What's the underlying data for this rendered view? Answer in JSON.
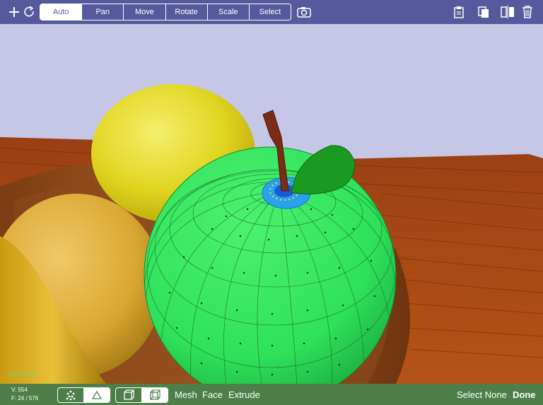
{
  "toolbar": {
    "add_icon": "plus-icon",
    "redo_icon": "redo-icon",
    "modes": [
      "Auto",
      "Pan",
      "Move",
      "Rotate",
      "Scale",
      "Select"
    ],
    "active_mode": "Auto",
    "camera_icon": "camera-icon",
    "right_icons": [
      "clipboard-icon",
      "duplicate-icon",
      "mirror-icon",
      "trash-icon"
    ],
    "bar_color": "#565a9c"
  },
  "status": {
    "mode_label": "Edit Mode",
    "vertices": "V: 554",
    "faces": "F: 24 / 576"
  },
  "bottom_bar": {
    "selection_modes": [
      "vertices-icon",
      "triangle-icon"
    ],
    "active_selection_mode": "vertices-icon",
    "view_modes": [
      "cube-icon",
      "cube-outline-icon"
    ],
    "active_view_mode": "cube-outline-icon",
    "mesh_label": "Mesh",
    "face_label": "Face",
    "extrude_label": "Extrude",
    "select_none_label": "Select None",
    "done_label": "Done",
    "bar_color": "#4e7f49"
  },
  "scene": {
    "selected_object": "apple",
    "apple_color": "#34e55a",
    "selection_color": "#2aa0ee"
  }
}
